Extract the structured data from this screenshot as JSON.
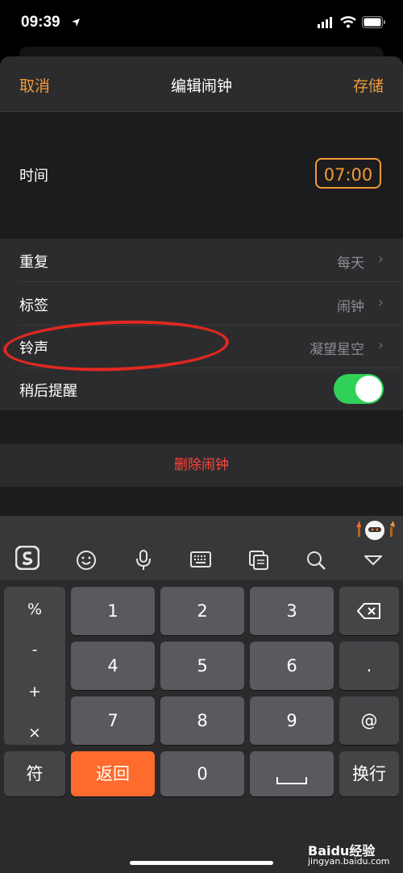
{
  "status_bar": {
    "time": "09:39",
    "location_icon": "location-arrow-icon",
    "signal_icon": "signal-icon",
    "wifi_icon": "wifi-icon",
    "battery_icon": "battery-icon"
  },
  "nav": {
    "cancel": "取消",
    "title": "编辑闹钟",
    "save": "存储"
  },
  "time_row": {
    "label": "时间",
    "value": "07:00"
  },
  "settings": [
    {
      "label": "重复",
      "value": "每天"
    },
    {
      "label": "标签",
      "value": "闹钟"
    },
    {
      "label": "铃声",
      "value": "凝望星空"
    },
    {
      "label": "稍后提醒",
      "toggle": true
    }
  ],
  "chevron": "›",
  "delete_label": "删除闹钟",
  "keyboard": {
    "toolbar": [
      "sogou-logo-icon",
      "emoji-icon",
      "microphone-icon",
      "keyboard-icon",
      "clipboard-icon",
      "search-icon",
      "hide-keyboard-icon"
    ],
    "symbols": [
      "%",
      "-",
      "+",
      "×"
    ],
    "digits": [
      "1",
      "2",
      "3",
      "4",
      "5",
      "6",
      "7",
      "8",
      "9"
    ],
    "backspace_icon": "backspace-icon",
    "dot": ".",
    "at": "@",
    "symbol_key": "符",
    "back_key": "返回",
    "zero": "0",
    "newline_key": "换行",
    "space_icon": "space-bar-icon"
  },
  "watermark": {
    "brand": "Baidu经验",
    "url": "jingyan.baidu.com"
  },
  "colors": {
    "accent": "#f09a37",
    "toggle_on": "#30d158",
    "delete": "#ff453a",
    "return_key": "#ff6b2c",
    "annotation": "#e0281f"
  }
}
